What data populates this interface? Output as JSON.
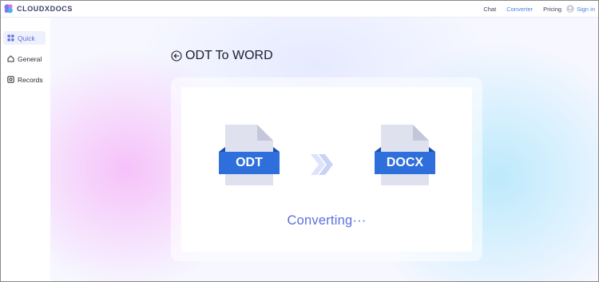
{
  "header": {
    "brand": "CLOUDXDOCS",
    "nav": [
      "Chat",
      "Converter",
      "Pricing"
    ],
    "active_nav": "Converter",
    "signin_label": "Sign in"
  },
  "sidebar": {
    "items": [
      {
        "label": "Quick",
        "icon": "grid-icon",
        "active": true
      },
      {
        "label": "General",
        "icon": "home-icon",
        "active": false
      },
      {
        "label": "Records",
        "icon": "records-icon",
        "active": false
      }
    ]
  },
  "main": {
    "title": "ODT To WORD",
    "source_format": "ODT",
    "target_format": "DOCX",
    "status": "Converting···"
  },
  "colors": {
    "accent": "#4f7de8",
    "file_band": "#2f6fdc",
    "status_text": "#5b6fe0"
  }
}
